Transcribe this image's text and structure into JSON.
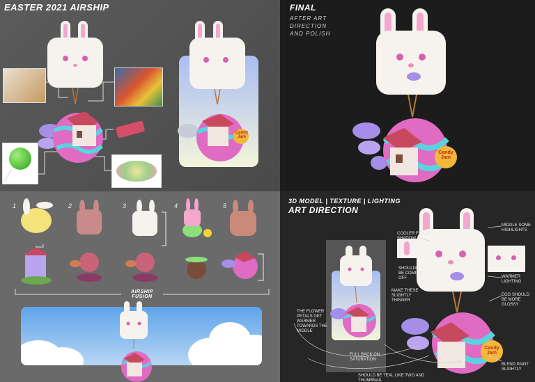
{
  "panels": {
    "concept": {
      "title": "EASTER 2021 AIRSHIP"
    },
    "final": {
      "title": "FINAL",
      "subtitle_lines": [
        "AFTER ART",
        "DIRECTION",
        "AND POLISH"
      ]
    },
    "iterations": {
      "numbers": [
        "1",
        "2",
        "3",
        "4",
        "5"
      ],
      "caption": "AIRSHIP FUSION"
    },
    "art_direction": {
      "title_line1": "3D MODEL | TEXTURE | LIGHTING",
      "title_line2": "ART DIRECTION",
      "notes": [
        "COOLER FOAM SHADOW",
        "WARMER LIGHTING",
        "SHOULDN'T BE COMING OFF",
        "MAKE THESE SLIGHTLY THINNER",
        "THE FLOWER PETALS GET WARMER TOWARDS THE MIDDLE",
        "FULL BACK ON SATURATION",
        "SHOULD BE TEAL LIKE TWO AND THUMBNAIL",
        "BLEND PAINT SLIGHTLY",
        "MIDDLE SOME HIGHLIGHTS",
        "EGG SHOULD BE MORE GLOSSY"
      ]
    }
  },
  "logo_text": "Candy Jam",
  "colors": {
    "egg_pink": "#e06bc2",
    "egg_teal": "#5ad3e0",
    "petal": "#a58ee8",
    "roof": "#c8485e",
    "bunny": "#f6f3ee",
    "ear_inner": "#f4a7cc"
  }
}
